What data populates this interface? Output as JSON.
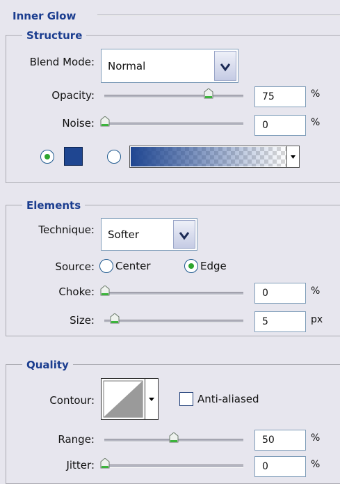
{
  "panel_title": "Inner Glow",
  "structure": {
    "title": "Structure",
    "blend_mode_label": "Blend Mode:",
    "blend_mode_value": "Normal",
    "opacity_label": "Opacity:",
    "opacity_value": "75",
    "opacity_unit": "%",
    "noise_label": "Noise:",
    "noise_value": "0",
    "noise_unit": "%",
    "color_swatch": "#1f4691",
    "gradient_start": "#1f4691"
  },
  "elements": {
    "title": "Elements",
    "technique_label": "Technique:",
    "technique_value": "Softer",
    "source_label": "Source:",
    "source_center": "Center",
    "source_edge": "Edge",
    "source_selected": "Edge",
    "choke_label": "Choke:",
    "choke_value": "0",
    "choke_unit": "%",
    "size_label": "Size:",
    "size_value": "5",
    "size_unit": "px"
  },
  "quality": {
    "title": "Quality",
    "contour_label": "Contour:",
    "anti_aliased_label": "Anti-aliased",
    "anti_aliased_checked": false,
    "range_label": "Range:",
    "range_value": "50",
    "range_unit": "%",
    "jitter_label": "Jitter:",
    "jitter_value": "0",
    "jitter_unit": "%"
  },
  "colors": {
    "header_text": "#1b3d8f",
    "radio_dot": "#2ea52e"
  }
}
